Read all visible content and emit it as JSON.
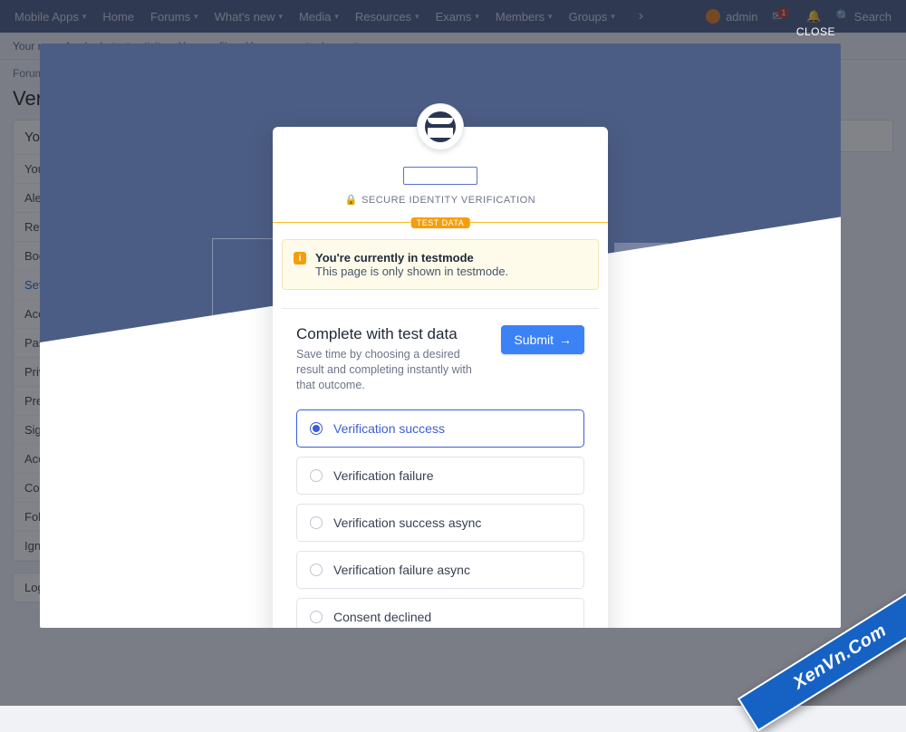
{
  "nav": {
    "items": [
      {
        "label": "Mobile Apps",
        "dropdown": true
      },
      {
        "label": "Home",
        "dropdown": false
      },
      {
        "label": "Forums",
        "dropdown": true
      },
      {
        "label": "What's new",
        "dropdown": true
      },
      {
        "label": "Media",
        "dropdown": true
      },
      {
        "label": "Resources",
        "dropdown": true
      },
      {
        "label": "Exams",
        "dropdown": true
      },
      {
        "label": "Members",
        "dropdown": true
      },
      {
        "label": "Groups",
        "dropdown": true
      }
    ],
    "username": "admin",
    "inbox_badge": "1",
    "search_label": "Search"
  },
  "subnav": [
    "Your news feed",
    "Latest activity",
    "Your profile",
    "Your account",
    "Log out"
  ],
  "breadcrumb": "Forums",
  "page_title": "Veri",
  "sidebar": {
    "header": "You",
    "items": [
      "You",
      "Ale",
      "Rea",
      "Boo",
      "Sett",
      "Acc",
      "Pass",
      "Priv",
      "Pref",
      "Sign",
      "Acc",
      "Con",
      "Follo",
      "Igno"
    ],
    "active_index": 4,
    "logout": "Log"
  },
  "modal": {
    "close": "CLOSE",
    "secure": "SECURE IDENTITY VERIFICATION",
    "test_badge": "TEST DATA",
    "notice": {
      "title": "You're currently in testmode",
      "body": "This page is only shown in testmode."
    },
    "section": {
      "title": "Complete with test data",
      "desc": "Save time by choosing a desired result and completing instantly with that outcome.",
      "submit": "Submit"
    },
    "options": [
      "Verification success",
      "Verification failure",
      "Verification success async",
      "Verification failure async",
      "Consent declined"
    ],
    "selected_option": 0
  },
  "ribbon": "XenVn.Com"
}
